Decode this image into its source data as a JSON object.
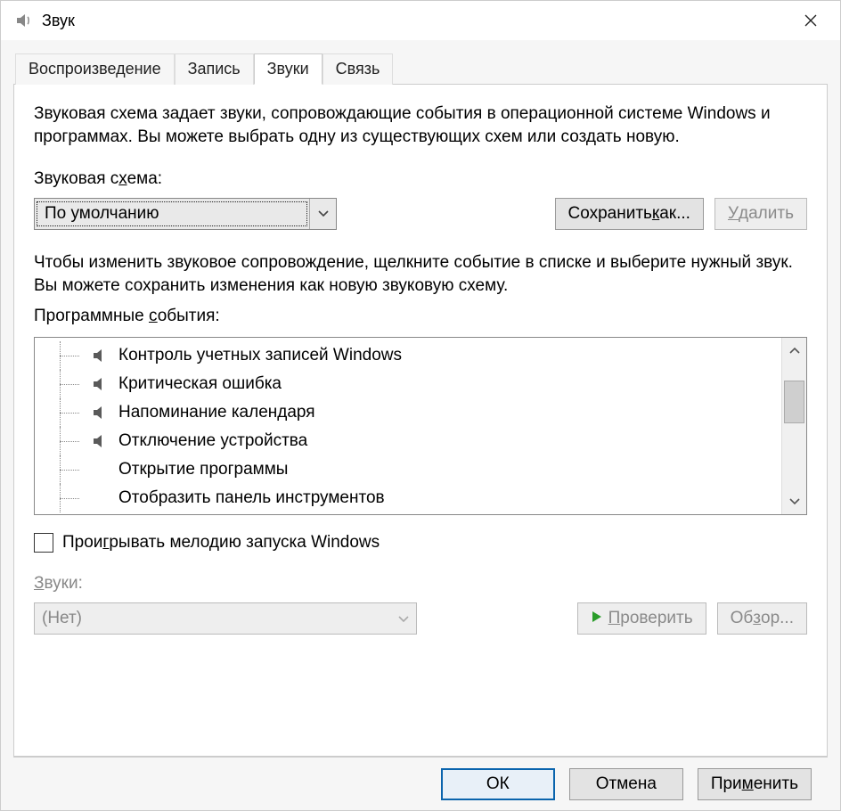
{
  "title": "Звук",
  "tabs": [
    "Воспроизведение",
    "Запись",
    "Звуки",
    "Связь"
  ],
  "active_tab": 2,
  "desc1": "Звуковая схема задает звуки, сопровождающие события в операционной системе Windows и программах. Вы можете выбрать одну из существующих схем или создать новую.",
  "scheme_label_pre": "Звуковая с",
  "scheme_label_u": "х",
  "scheme_label_post": "ема:",
  "scheme_value": "По умолчанию",
  "save_as_pre": "Сохранить ",
  "save_as_u": "к",
  "save_as_post": "ак...",
  "delete_u": "У",
  "delete_post": "далить",
  "desc2": "Чтобы изменить звуковое сопровождение, щелкните событие в списке и выберите нужный звук. Вы можете сохранить изменения как новую звуковую схему.",
  "events_label_pre": "Программные ",
  "events_label_u": "с",
  "events_label_post": "обытия:",
  "events": [
    {
      "icon": true,
      "label": "Контроль учетных записей Windows"
    },
    {
      "icon": true,
      "label": "Критическая ошибка"
    },
    {
      "icon": true,
      "label": "Напоминание календаря"
    },
    {
      "icon": true,
      "label": "Отключение устройства"
    },
    {
      "icon": false,
      "label": "Открытие программы"
    },
    {
      "icon": false,
      "label": "Отобразить панель инструментов"
    }
  ],
  "startup_pre": "Прои",
  "startup_u": "г",
  "startup_post": "рывать мелодию запуска Windows",
  "sounds_label_u": "З",
  "sounds_label_post": "вуки:",
  "sounds_value": "(Нет)",
  "test_u": "П",
  "test_post": "роверить",
  "browse_pre": "Об",
  "browse_u": "з",
  "browse_post": "ор...",
  "ok": "ОК",
  "cancel": "Отмена",
  "apply_pre": "При",
  "apply_u": "м",
  "apply_post": "енить"
}
